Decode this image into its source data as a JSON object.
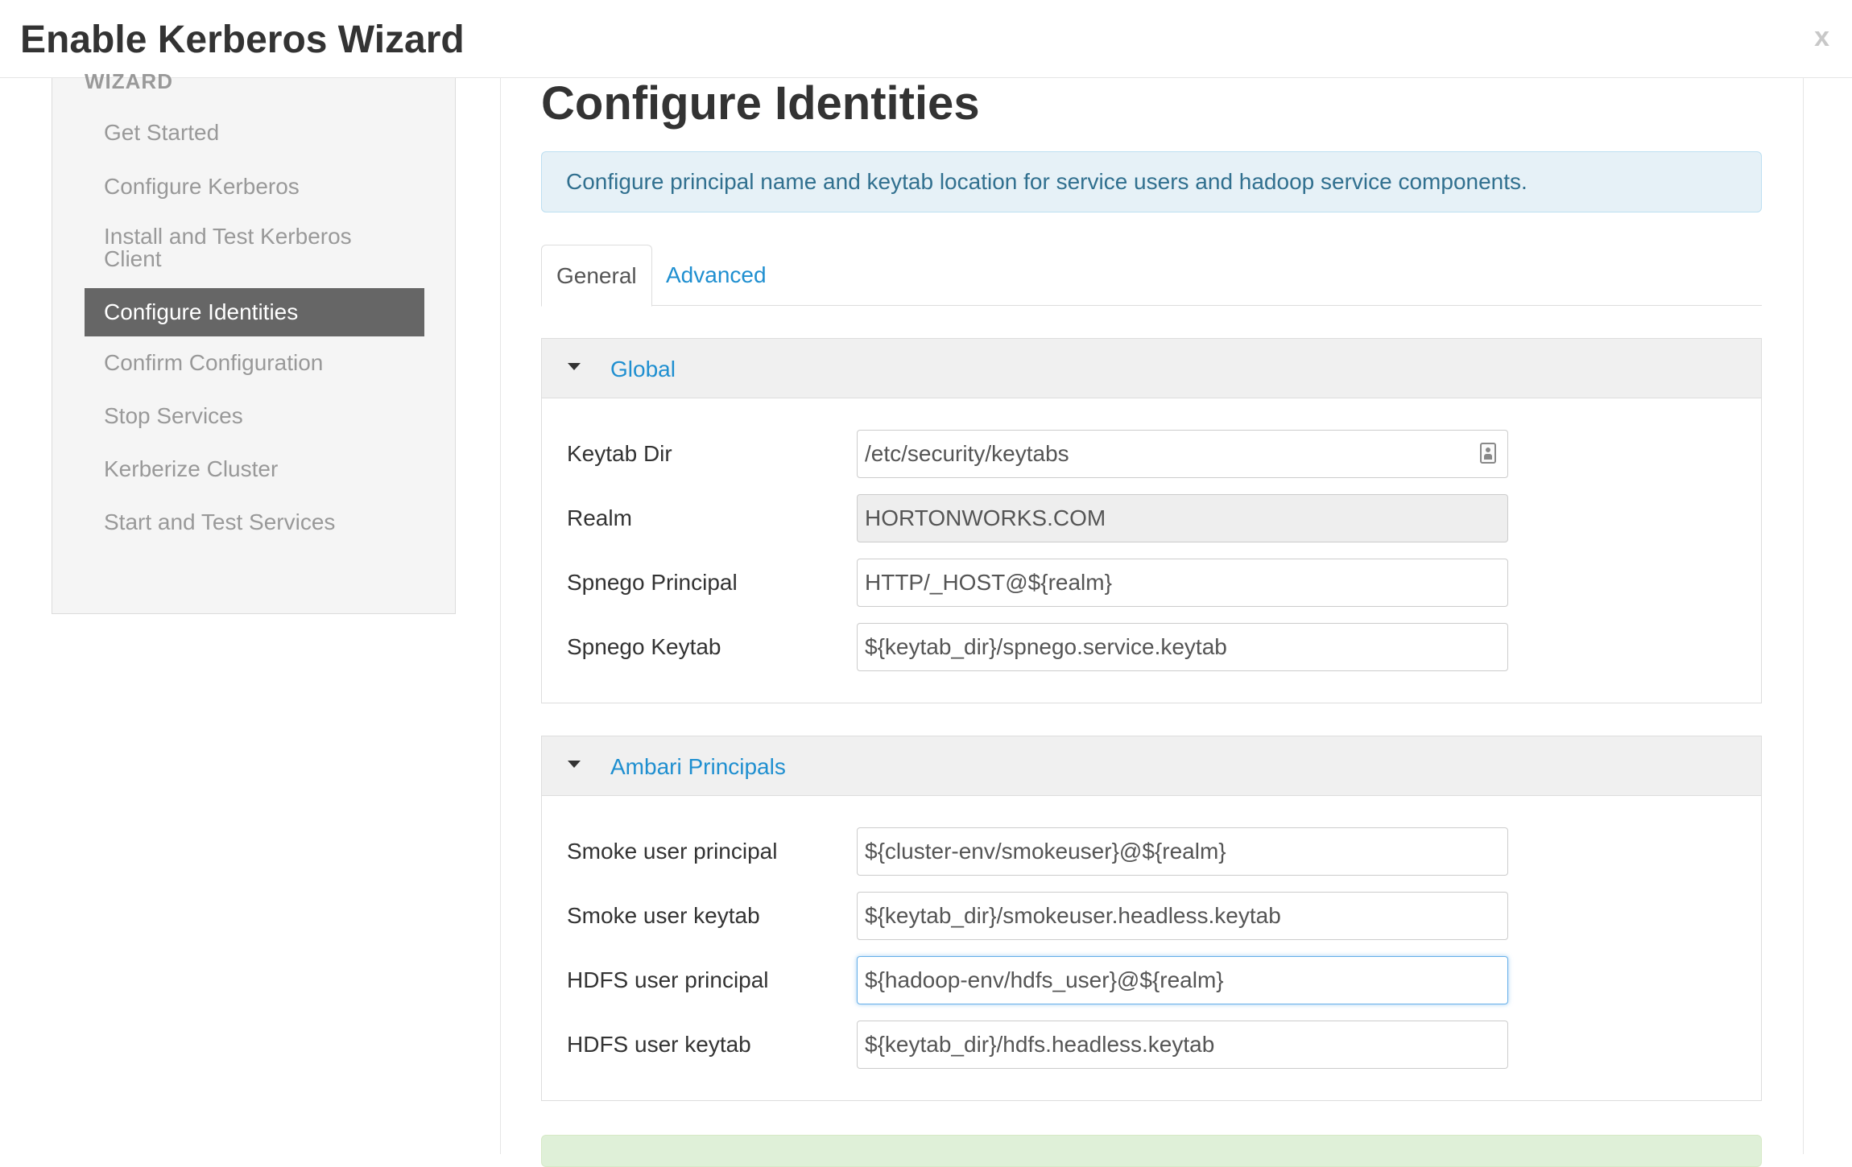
{
  "modal": {
    "title": "Enable Kerberos Wizard",
    "close_label": "x"
  },
  "sidebar": {
    "heading": "WIZARD",
    "items": [
      {
        "label": "Get Started",
        "active": false
      },
      {
        "label": "Configure Kerberos",
        "active": false
      },
      {
        "label": "Install and Test Kerberos Client",
        "active": false
      },
      {
        "label": "Configure Identities",
        "active": true
      },
      {
        "label": "Confirm Configuration",
        "active": false
      },
      {
        "label": "Stop Services",
        "active": false
      },
      {
        "label": "Kerberize Cluster",
        "active": false
      },
      {
        "label": "Start and Test Services",
        "active": false
      }
    ]
  },
  "main": {
    "title": "Configure Identities",
    "info": "Configure principal name and keytab location for service users and hadoop service components.",
    "tabs": [
      {
        "label": "General",
        "active": true
      },
      {
        "label": "Advanced",
        "active": false
      }
    ],
    "panels": [
      {
        "title": "Global",
        "fields": [
          {
            "label": "Keytab Dir",
            "value": "/etc/security/keytabs",
            "readonly": false,
            "icon": "contact-card-icon"
          },
          {
            "label": "Realm",
            "value": "HORTONWORKS.COM",
            "readonly": true
          },
          {
            "label": "Spnego Principal",
            "value": "HTTP/_HOST@${realm}",
            "readonly": false
          },
          {
            "label": "Spnego Keytab",
            "value": "${keytab_dir}/spnego.service.keytab",
            "readonly": false
          }
        ]
      },
      {
        "title": "Ambari Principals",
        "fields": [
          {
            "label": "Smoke user principal",
            "value": "${cluster-env/smokeuser}@${realm}",
            "readonly": false
          },
          {
            "label": "Smoke user keytab",
            "value": "${keytab_dir}/smokeuser.headless.keytab",
            "readonly": false
          },
          {
            "label": "HDFS user principal",
            "value": "${hadoop-env/hdfs_user}@${realm}",
            "readonly": false,
            "focused": true
          },
          {
            "label": "HDFS user keytab",
            "value": "${keytab_dir}/hdfs.headless.keytab",
            "readonly": false
          }
        ]
      }
    ]
  },
  "colors": {
    "link": "#1f8fd0",
    "active_nav_bg": "#666666",
    "info_bg": "#e6f1f7",
    "success_bg": "#dff0d8"
  }
}
